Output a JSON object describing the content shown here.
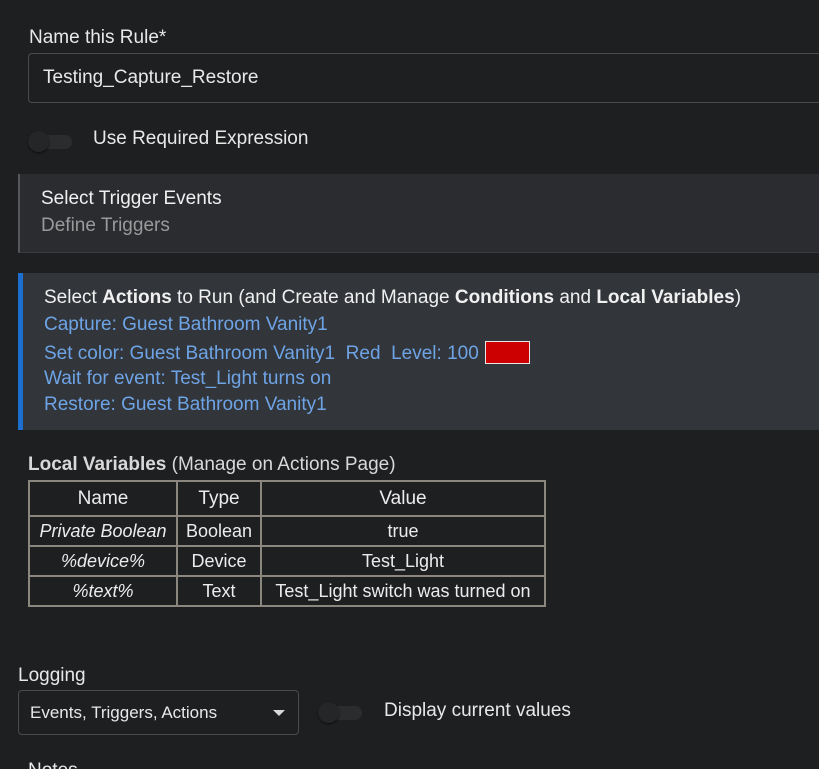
{
  "rule_name": {
    "label": "Name this Rule*",
    "value": "Testing_Capture_Restore"
  },
  "required_expression": {
    "label": "Use Required Expression",
    "enabled": false
  },
  "triggers": {
    "title": "Select Trigger Events",
    "subtitle": "Define Triggers"
  },
  "actions": {
    "title_parts": {
      "p1": "Select ",
      "b1": "Actions",
      "p2": " to Run (and Create and Manage ",
      "b2": "Conditions",
      "p3": " and ",
      "b3": "Local Variables",
      "p4": ")"
    },
    "items": [
      "Capture: Guest Bathroom Vanity1",
      "Set color: Guest Bathroom Vanity1  Red  Level: 100",
      "Wait for event: Test_Light turns on",
      "Restore: Guest Bathroom Vanity1"
    ],
    "color_swatch": "#cc0000"
  },
  "local_variables": {
    "heading_bold": "Local Variables",
    "heading_rest": " (Manage on Actions Page)",
    "columns": [
      "Name",
      "Type",
      "Value"
    ],
    "rows": [
      {
        "name": "Private Boolean",
        "type": "Boolean",
        "value": "true"
      },
      {
        "name": "%device%",
        "type": "Device",
        "value": "Test_Light"
      },
      {
        "name": "%text%",
        "type": "Text",
        "value": "Test_Light switch was turned on"
      }
    ]
  },
  "logging": {
    "label": "Logging",
    "selected": "Events, Triggers, Actions",
    "display_current_values_label": "Display current values",
    "display_current_values_enabled": false
  },
  "next_section_label": "Notes",
  "colors": {
    "accent": "#1d6fcf",
    "link": "#6ea4e6",
    "background": "#1e1f21"
  }
}
